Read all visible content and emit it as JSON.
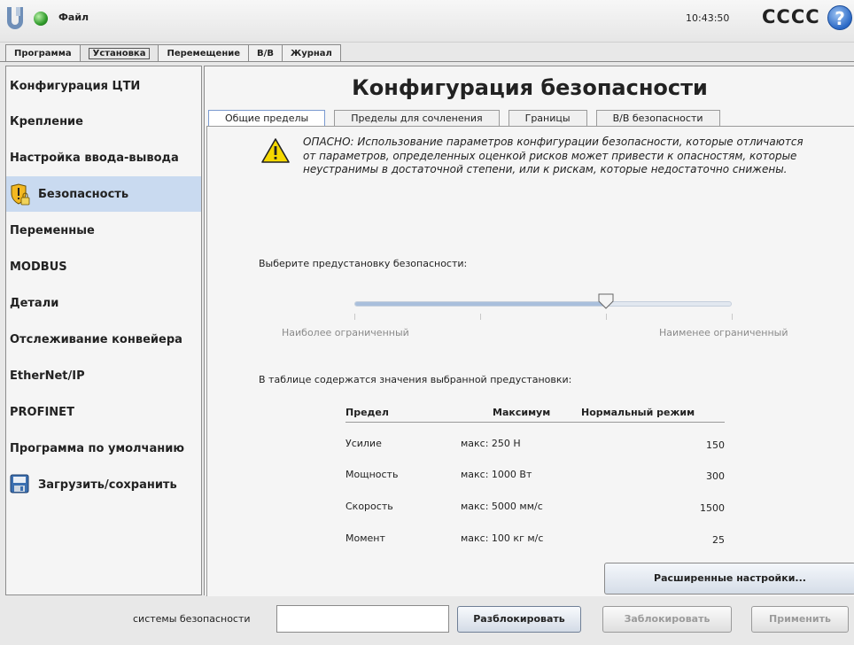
{
  "topbar": {
    "menu_label": "Файл",
    "time": "10:43:50",
    "robot_name": "CCCC",
    "help_glyph": "?"
  },
  "main_tabs": [
    {
      "label": "Программа"
    },
    {
      "label": "Установка"
    },
    {
      "label": "Перемещение"
    },
    {
      "label": "В/В"
    },
    {
      "label": "Журнал"
    }
  ],
  "sidebar": {
    "items": [
      {
        "label": "Конфигурация ЦТИ"
      },
      {
        "label": "Крепление"
      },
      {
        "label": "Настройка ввода-вывода"
      },
      {
        "label": "Безопасность",
        "icon": "safety-shield-lock-icon"
      },
      {
        "label": "Переменные"
      },
      {
        "label": "MODBUS"
      },
      {
        "label": "Детали"
      },
      {
        "label": "Отслеживание конвейера"
      },
      {
        "label": "EtherNet/IP"
      },
      {
        "label": "PROFINET"
      },
      {
        "label": "Программа по умолчанию"
      },
      {
        "label": "Загрузить/сохранить",
        "icon": "floppy-disk-icon"
      }
    ]
  },
  "main": {
    "title": "Конфигурация безопасности",
    "sub_tabs": [
      {
        "label": "Общие пределы"
      },
      {
        "label": "Пределы для сочленения"
      },
      {
        "label": "Границы"
      },
      {
        "label": "В/В безопасности"
      }
    ],
    "warning_text": "ОПАСНО: Использование параметров конфигурации безопасности, которые отличаются от параметров, определенных оценкой рисков может привести к опасностям, которые неустранимы в достаточной степени, или к рискам, которые недостаточно снижены.",
    "preset_label": "Выберите предустановку безопасности:",
    "slider": {
      "min_label": "Наиболее ограниченный",
      "max_label": "Наименее ограниченный",
      "steps": 4,
      "selected_index": 2
    },
    "table_label": "В таблице содержатся значения выбранной предустановки:",
    "table": {
      "headers": [
        "Предел",
        "Максимум",
        "Нормальный режим"
      ],
      "rows": [
        {
          "limit": "Усилие",
          "max": "макс: 250 Н",
          "normal": "150"
        },
        {
          "limit": "Мощность",
          "max": "макс: 1000 Вт",
          "normal": "300"
        },
        {
          "limit": "Скорость",
          "max": "макс: 5000 мм/с",
          "normal": "1500"
        },
        {
          "limit": "Момент",
          "max": "макс: 100 кг м/с",
          "normal": "25"
        }
      ]
    },
    "advanced_button": "Расширенные настройки..."
  },
  "bottombar": {
    "password_label": "системы безопасности",
    "password_value": "",
    "unlock_button": "Разблокировать",
    "lock_button": "Заблокировать",
    "apply_button": "Применить"
  },
  "colors": {
    "active_sidebar": "#c9daf0",
    "warning_yellow": "#f5d800",
    "status_green": "#2f9a2a",
    "help_blue": "#2b69c6"
  }
}
